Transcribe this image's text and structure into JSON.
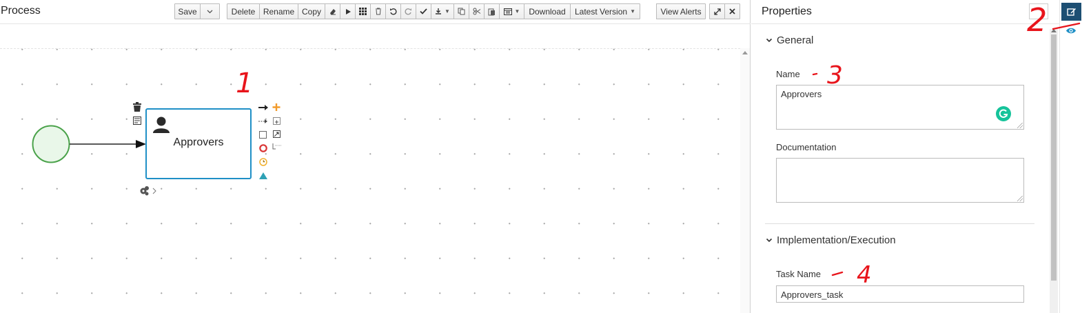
{
  "editor": {
    "title": "Process",
    "toolbar": {
      "save_label": "Save",
      "delete_label": "Delete",
      "rename_label": "Rename",
      "copy_label": "Copy",
      "download_label": "Download",
      "latest_version_label": "Latest Version",
      "view_alerts_label": "View Alerts"
    }
  },
  "diagram": {
    "task_label": "Approvers"
  },
  "properties": {
    "title": "Properties",
    "sections": {
      "general": "General",
      "implementation": "Implementation/Execution"
    },
    "fields": {
      "name_label": "Name",
      "name_value": "Approvers",
      "documentation_label": "Documentation",
      "documentation_value": "",
      "task_name_label": "Task Name",
      "task_name_value": "Approvers_task"
    }
  },
  "annotations": {
    "a1": "1",
    "a2": "2",
    "a3": "3",
    "a4": "4"
  },
  "colors": {
    "accent": "#1d4f73",
    "task_border": "#1e8fc6",
    "start_event_stroke": "#4aa24a",
    "start_event_fill": "#e9f7e9",
    "annotation_red": "#e8141b",
    "grammarly": "#15c39a"
  },
  "icons": [
    "chevron-down-icon",
    "eraser-icon",
    "play-icon",
    "grid-icon",
    "trash-icon",
    "undo-icon",
    "redo-icon",
    "check-icon",
    "import-icon",
    "copy-icon",
    "cut-icon",
    "paste-icon",
    "view-icon",
    "expand-icon",
    "close-icon",
    "user-icon",
    "gears-icon",
    "edit-icon",
    "eye-icon"
  ]
}
